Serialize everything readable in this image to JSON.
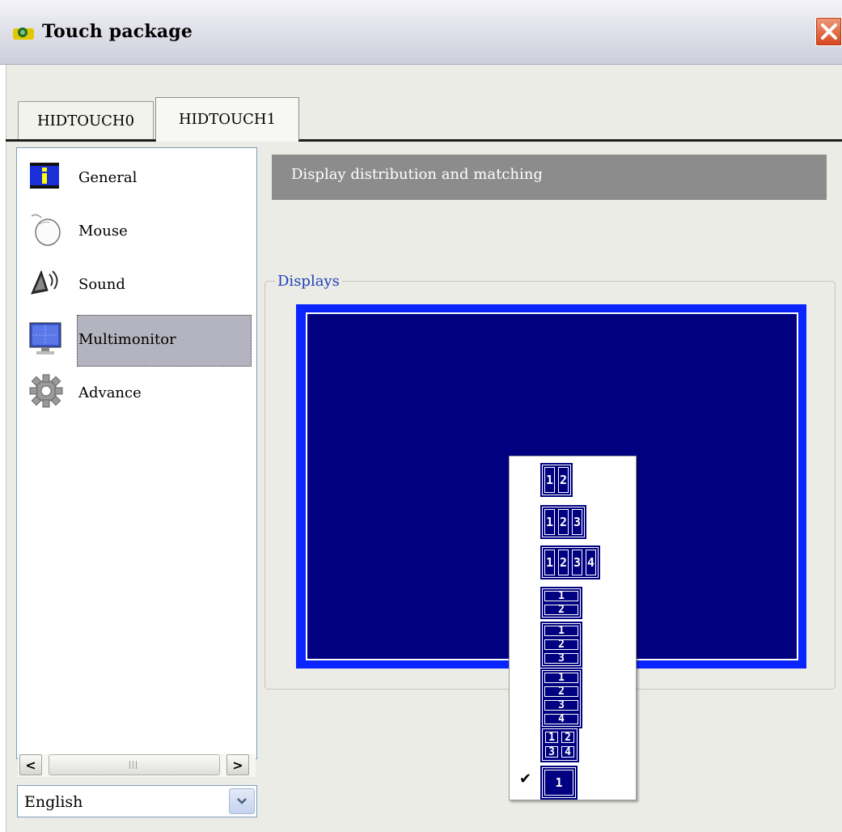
{
  "window": {
    "title": "Touch package",
    "app_icon": "app-icon",
    "close_icon": "close-icon"
  },
  "tabs": [
    {
      "label": "HIDTOUCH0"
    },
    {
      "label": "HIDTOUCH1",
      "selected": true
    }
  ],
  "sidebar": {
    "items": [
      {
        "label": "General",
        "icon": "info-icon"
      },
      {
        "label": "Mouse",
        "icon": "mouse-icon"
      },
      {
        "label": "Sound",
        "icon": "speaker-icon"
      },
      {
        "label": "Multimonitor",
        "icon": "monitor-icon",
        "selected": true
      },
      {
        "label": "Advance",
        "icon": "gear-icon"
      }
    ],
    "scrollbar": {
      "left_arrow": "<",
      "right_arrow": ">"
    }
  },
  "language": {
    "selected": "English"
  },
  "content": {
    "header": "Display distribution and matching",
    "group_label": "Displays"
  },
  "layout_menu": {
    "options": [
      {
        "id": "h2",
        "cells": [
          "1",
          "2"
        ]
      },
      {
        "id": "h3",
        "cells": [
          "1",
          "2",
          "3"
        ]
      },
      {
        "id": "h4",
        "cells": [
          "1",
          "2",
          "3",
          "4"
        ]
      },
      {
        "id": "v2",
        "cells": [
          "1",
          "2"
        ]
      },
      {
        "id": "v3",
        "cells": [
          "1",
          "2",
          "3"
        ]
      },
      {
        "id": "v4",
        "cells": [
          "1",
          "2",
          "3",
          "4"
        ]
      },
      {
        "id": "grid",
        "cells": [
          "1",
          "2",
          "3",
          "4"
        ]
      },
      {
        "id": "single",
        "cells": [
          "1"
        ],
        "checked": true
      }
    ],
    "check_mark": "✔"
  },
  "colors": {
    "display_blue": "#000080",
    "display_border": "#0a24ff",
    "header_gray": "#8c8c8c",
    "group_label": "#1c3fb8"
  }
}
